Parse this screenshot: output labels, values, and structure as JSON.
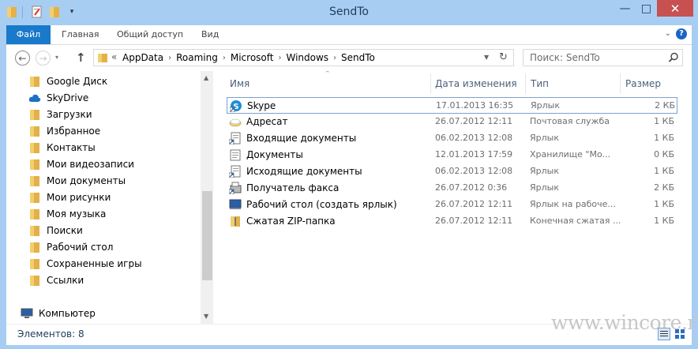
{
  "window": {
    "title": "SendTo",
    "controls": {
      "minimize": "—",
      "maximize": "□",
      "close": "✕"
    }
  },
  "ribbon": {
    "tabs": [
      "Файл",
      "Главная",
      "Общий доступ",
      "Вид"
    ]
  },
  "address": {
    "prefix": "«",
    "crumbs": [
      "AppData",
      "Roaming",
      "Microsoft",
      "Windows",
      "SendTo"
    ]
  },
  "search": {
    "placeholder": "Поиск: SendTo"
  },
  "nav_pane": {
    "items": [
      {
        "label": "Google Диск",
        "icon": "folder-icon"
      },
      {
        "label": "SkyDrive",
        "icon": "cloud-icon"
      },
      {
        "label": "Загрузки",
        "icon": "folder-icon"
      },
      {
        "label": "Избранное",
        "icon": "folder-icon"
      },
      {
        "label": "Контакты",
        "icon": "folder-icon"
      },
      {
        "label": "Мои видеозаписи",
        "icon": "folder-icon"
      },
      {
        "label": "Мои документы",
        "icon": "folder-icon"
      },
      {
        "label": "Мои рисунки",
        "icon": "folder-icon"
      },
      {
        "label": "Моя музыка",
        "icon": "folder-icon"
      },
      {
        "label": "Поиски",
        "icon": "folder-icon"
      },
      {
        "label": "Рабочий стол",
        "icon": "folder-icon"
      },
      {
        "label": "Сохраненные игры",
        "icon": "folder-icon"
      },
      {
        "label": "Ссылки",
        "icon": "folder-icon"
      }
    ],
    "computer": "Компьютер"
  },
  "columns": {
    "name": "Имя",
    "date": "Дата изменения",
    "type": "Тип",
    "size": "Размер"
  },
  "files": [
    {
      "name": "Skype",
      "date": "17.01.2013 16:35",
      "type": "Ярлык",
      "size": "2 КБ",
      "icon": "skype-shortcut-icon"
    },
    {
      "name": "Адресат",
      "date": "26.07.2012 12:11",
      "type": "Почтовая служба",
      "size": "1 КБ",
      "icon": "mail-recipient-icon"
    },
    {
      "name": "Входящие документы",
      "date": "06.02.2013 12:08",
      "type": "Ярлык",
      "size": "1 КБ",
      "icon": "document-shortcut-icon"
    },
    {
      "name": "Документы",
      "date": "12.01.2013 17:59",
      "type": "Хранилище \"Мо...",
      "size": "0 КБ",
      "icon": "library-icon"
    },
    {
      "name": "Исходящие документы",
      "date": "06.02.2013 12:08",
      "type": "Ярлык",
      "size": "1 КБ",
      "icon": "document-shortcut-icon"
    },
    {
      "name": "Получатель факса",
      "date": "26.07.2012 0:36",
      "type": "Ярлык",
      "size": "2 КБ",
      "icon": "fax-icon"
    },
    {
      "name": "Рабочий стол (создать ярлык)",
      "date": "26.07.2012 12:11",
      "type": "Ярлык на рабоче...",
      "size": "1 КБ",
      "icon": "desktop-icon"
    },
    {
      "name": "Сжатая ZIP-папка",
      "date": "26.07.2012 12:11",
      "type": "Конечная сжатая ...",
      "size": "1 КБ",
      "icon": "zip-folder-icon"
    }
  ],
  "status": {
    "items_count": "Элементов: 8",
    "watermark": "www.wincore.ru"
  },
  "colors": {
    "titlebar": "#a8cdf2",
    "file_tab": "#1979ca",
    "close_button": "#c75050",
    "selection_border": "#7da2ce"
  }
}
